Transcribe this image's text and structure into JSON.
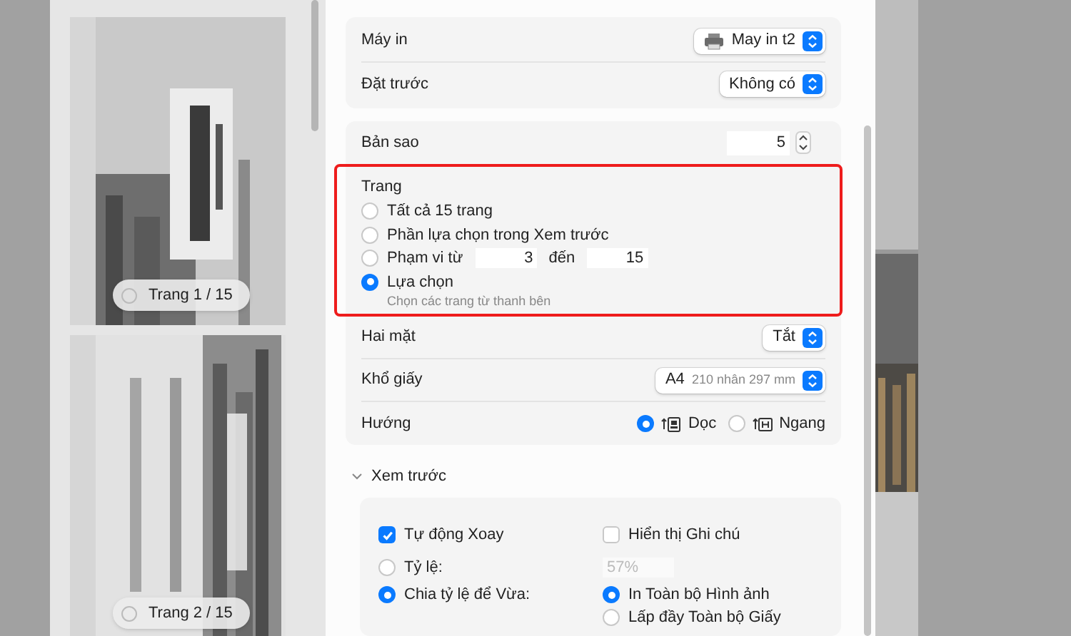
{
  "thumbnails": [
    {
      "label": "Trang 1 / 15",
      "selected": false
    },
    {
      "label": "Trang 2 / 15",
      "selected": false
    }
  ],
  "printer": {
    "label": "Máy in",
    "value": "May in t2"
  },
  "presets": {
    "label": "Đặt trước",
    "value": "Không có"
  },
  "copies": {
    "label": "Bản sao",
    "value": "5"
  },
  "pages": {
    "title": "Trang",
    "options": [
      {
        "kind": "plain",
        "label": "Tất cả 15 trang",
        "selected": false
      },
      {
        "kind": "plain",
        "label": "Phần lựa chọn trong Xem trước",
        "selected": false
      },
      {
        "kind": "range",
        "label": "Phạm vi từ",
        "from": "3",
        "to_label": "đến",
        "to": "15",
        "selected": false
      },
      {
        "kind": "plain",
        "label": "Lựa chọn",
        "hint": "Chọn các trang từ thanh bên",
        "selected": true
      }
    ]
  },
  "two_sided": {
    "label": "Hai mặt",
    "value": "Tắt"
  },
  "paper_size": {
    "label": "Khổ giấy",
    "value": "A4",
    "detail": "210 nhân 297 mm"
  },
  "orientation": {
    "label": "Hướng",
    "options": [
      {
        "kind": "portrait",
        "label": "Dọc",
        "selected": true
      },
      {
        "kind": "landscape",
        "label": "Ngang",
        "selected": false
      }
    ]
  },
  "preview": {
    "title": "Xem trước",
    "expanded": true,
    "auto_rotate": {
      "label": "Tự động Xoay",
      "checked": true
    },
    "show_notes": {
      "label": "Hiển thị Ghi chú",
      "checked": false
    },
    "scale": {
      "label": "Tỷ lệ:",
      "value": "57%",
      "selected": false,
      "disabled": true
    },
    "fit": {
      "label": "Chia tỷ lệ để Vừa:",
      "selected": true
    },
    "fit_options": [
      {
        "label": "In Toàn bộ Hình ảnh",
        "selected": true
      },
      {
        "label": "Lấp đầy Toàn bộ Giấy",
        "selected": false
      }
    ]
  }
}
